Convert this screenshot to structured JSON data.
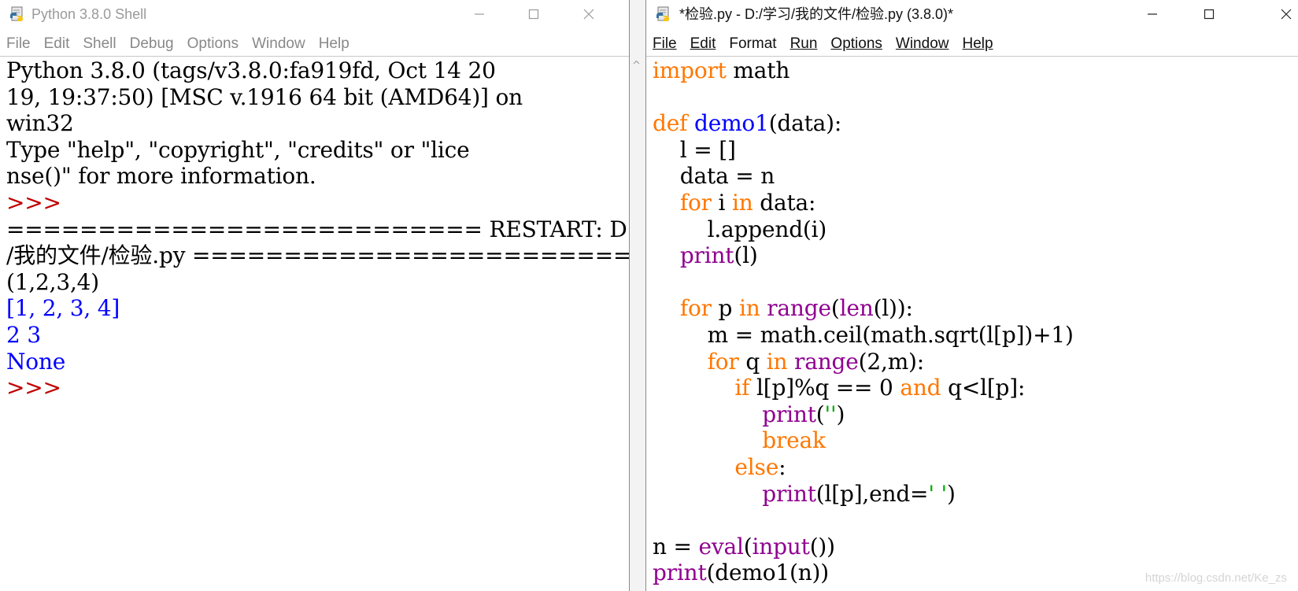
{
  "shell": {
    "title": "Python 3.8.0 Shell",
    "menu": [
      "File",
      "Edit",
      "Shell",
      "Debug",
      "Options",
      "Window",
      "Help"
    ],
    "lines": [
      "Python 3.8.0 (tags/v3.8.0:fa919fd, Oct 14 20",
      "19, 19:37:50) [MSC v.1916 64 bit (AMD64)] on",
      "win32",
      "Type \"help\", \"copyright\", \"credits\" or \"lice",
      "nse()\" for more information.",
      ">>> ",
      "========================== RESTART: D:/学习",
      "/我的文件/检验.py ==========================",
      "(1,2,3,4)",
      "[1, 2, 3, 4]",
      "2 3",
      "None",
      ">>> "
    ]
  },
  "editor": {
    "title": "*检验.py - D:/学习/我的文件/检验.py (3.8.0)*",
    "menu": [
      "File",
      "Edit",
      "Format",
      "Run",
      "Options",
      "Window",
      "Help"
    ],
    "lines": {
      "l0": {
        "kw": "import",
        "rest": " math"
      },
      "l2": {
        "kw": "def",
        "fn": "demo1",
        "rest": "(data):"
      },
      "l3": " l = []",
      "l4": " data = n",
      "l5": {
        "kw": "for",
        "a": " i ",
        "kw2": "in",
        "b": " data:"
      },
      "l6": " l.append(i)",
      "l7": {
        "bi": "print",
        "rest": "(l)"
      },
      "l9": {
        "kw": "for",
        "a": " p ",
        "kw2": "in",
        "sp": " ",
        "bi": "range",
        "p1": "(",
        "bi2": "len",
        "rest": "(l)):"
      },
      "l10": " m = math.ceil(math.sqrt(l[p])+1)",
      "l11": {
        "kw": "for",
        "a": " q ",
        "kw2": "in",
        "sp": " ",
        "bi": "range",
        "rest": "(2,m):"
      },
      "l12": {
        "kw": "if",
        "a": " l[p]%q == 0 ",
        "kw2": "and",
        "b": " q<l[p]:"
      },
      "l13": {
        "bi": "print",
        "p1": "(",
        "str": "''",
        "rest": ")"
      },
      "l14": "break",
      "l15": "else",
      "l15b": ":",
      "l16": {
        "bi": "print",
        "a": "(l[p],end=",
        "str": "' '",
        "rest": ")"
      },
      "l18": {
        "a": "n = ",
        "bi": "eval",
        "p1": "(",
        "bi2": "input",
        "rest": "())"
      },
      "l19": {
        "bi": "print",
        "rest": "(demo1(n))"
      }
    }
  },
  "watermark": "https://blog.csdn.net/Ke_zs",
  "colors": {
    "keyword": "#ff7700",
    "builtin": "#900090",
    "definition": "#0000ff",
    "string": "#00aa00",
    "prompt": "#c00000",
    "stdout": "#0000ff"
  },
  "icons": [
    "python-idle-icon",
    "minimize-icon",
    "maximize-icon",
    "close-icon"
  ]
}
